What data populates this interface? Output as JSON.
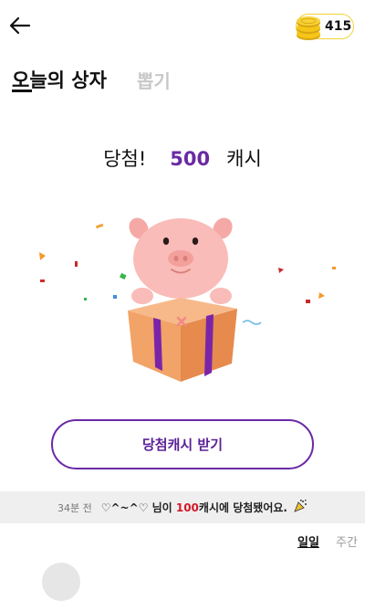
{
  "header": {
    "back_icon": "arrow-left-icon",
    "coin_icon": "coin-stack-icon",
    "coin_count": "415"
  },
  "tabs": [
    {
      "label": "오늘의 상자",
      "active": true
    },
    {
      "label": "뽑기",
      "active": false
    }
  ],
  "prize": {
    "prefix": "당첨!",
    "amount": "500",
    "unit": "캐시"
  },
  "claim_button": {
    "label": "당첨캐시 받기"
  },
  "ticker": {
    "time": "34분 전",
    "user": "♡^~^♡",
    "text_before_amount": " 님이 ",
    "amount": "100",
    "text_after_amount": "캐시에 당첨됐어요.",
    "party_icon": "party-popper-icon"
  },
  "period_tabs": [
    {
      "label": "일일",
      "active": true
    },
    {
      "label": "주간",
      "active": false
    }
  ],
  "colors": {
    "accent_purple": "#6b2aa7",
    "highlight_red": "#d21a2a",
    "coin_gold": "#f0c419",
    "box_orange": "#f2a66a",
    "pig_pink": "#f8b7b4"
  }
}
